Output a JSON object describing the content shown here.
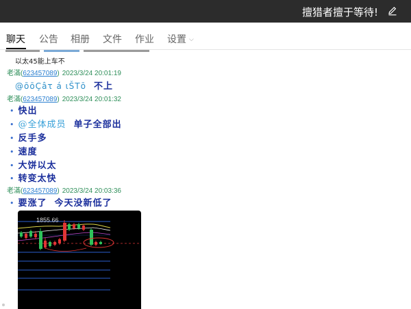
{
  "window": {
    "title": "擅猎者擅于等待!",
    "edit_icon": "pencil-icon"
  },
  "tabs": [
    {
      "label": "聊天",
      "active": true
    },
    {
      "label": "公告"
    },
    {
      "label": "相册"
    },
    {
      "label": "文件"
    },
    {
      "label": "作业"
    },
    {
      "label": "设置",
      "has_dropdown": true
    }
  ],
  "messages": {
    "m0_text": "以太45能上车不",
    "m1_header": {
      "name": "老滿",
      "qq": "623457089",
      "time": "2023/3/24 20:01:19"
    },
    "m1_lines": [
      {
        "garbled": "@ōōÇâτ á ιŠTō",
        "text": "不上"
      }
    ],
    "m2_header": {
      "name": "老滿",
      "qq": "623457089",
      "time": "2023/3/24 20:01:32"
    },
    "m2_lines": [
      {
        "text": "快出"
      },
      {
        "mention": "@全体成员",
        "text": "单子全部出"
      },
      {
        "text": "反手多"
      },
      {
        "text": "速度"
      },
      {
        "text": "大饼以太"
      },
      {
        "text": "转变太快"
      }
    ],
    "m3_header": {
      "name": "老滿",
      "qq": "623457089",
      "time": "2023/3/24 20:03:36"
    },
    "m3_lines": [
      {
        "text": "要涨了  今天没新低了"
      }
    ],
    "m3_image": {
      "price_label": "1855.66"
    }
  },
  "colors": {
    "name": "#2f8f5a",
    "qq_link": "#2a7fd0",
    "message_text": "#1b2f9c",
    "titlebar": "#2c2c2c"
  }
}
